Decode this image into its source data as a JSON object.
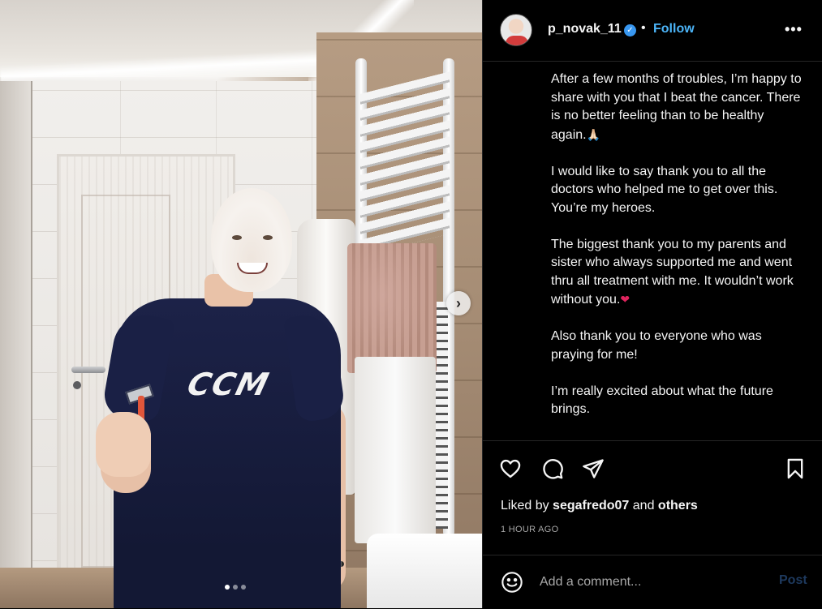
{
  "post": {
    "username": "p_novak_11",
    "separator": "•",
    "follow_label": "Follow",
    "more_label": "•••",
    "caption": {
      "p1": "After a few months of troubles, I’m happy to share with you that I beat the cancer. There is no better feeling than to be healthy again.",
      "p1_emoji": "🙏🏻",
      "p2": "I would like to say thank you to all the doctors who helped me to get over this. You’re my heroes.",
      "p3": "The biggest thank you to my parents and sister who always supported me and went thru all treatment with me. It wouldn’t work without you.",
      "p3_emoji": "❤",
      "p4": "Also thank you to everyone who was praying for me!",
      "p5": "I’m really excited about what the future brings."
    },
    "likes": {
      "prefix": "Liked by",
      "user": "segafredo07",
      "conjunction": "and",
      "others": "others"
    },
    "timestamp": "1 HOUR AGO",
    "comment": {
      "placeholder": "Add a comment...",
      "post_label": "Post"
    },
    "carousel": {
      "slides": 3,
      "active": 1
    },
    "photo": {
      "shirt_text": "CCM"
    }
  },
  "colors": {
    "accent": "#4cb5f9",
    "background": "#000000",
    "text": "#f5f5f5",
    "muted": "#a8a8a8",
    "post_disabled": "#1e3a5f"
  },
  "icons": {
    "verified": "verified-badge-icon",
    "like": "heart-icon",
    "comment": "comment-icon",
    "share": "paper-plane-icon",
    "save": "bookmark-icon",
    "emoji": "smiley-icon",
    "next": "chevron-right-icon"
  }
}
